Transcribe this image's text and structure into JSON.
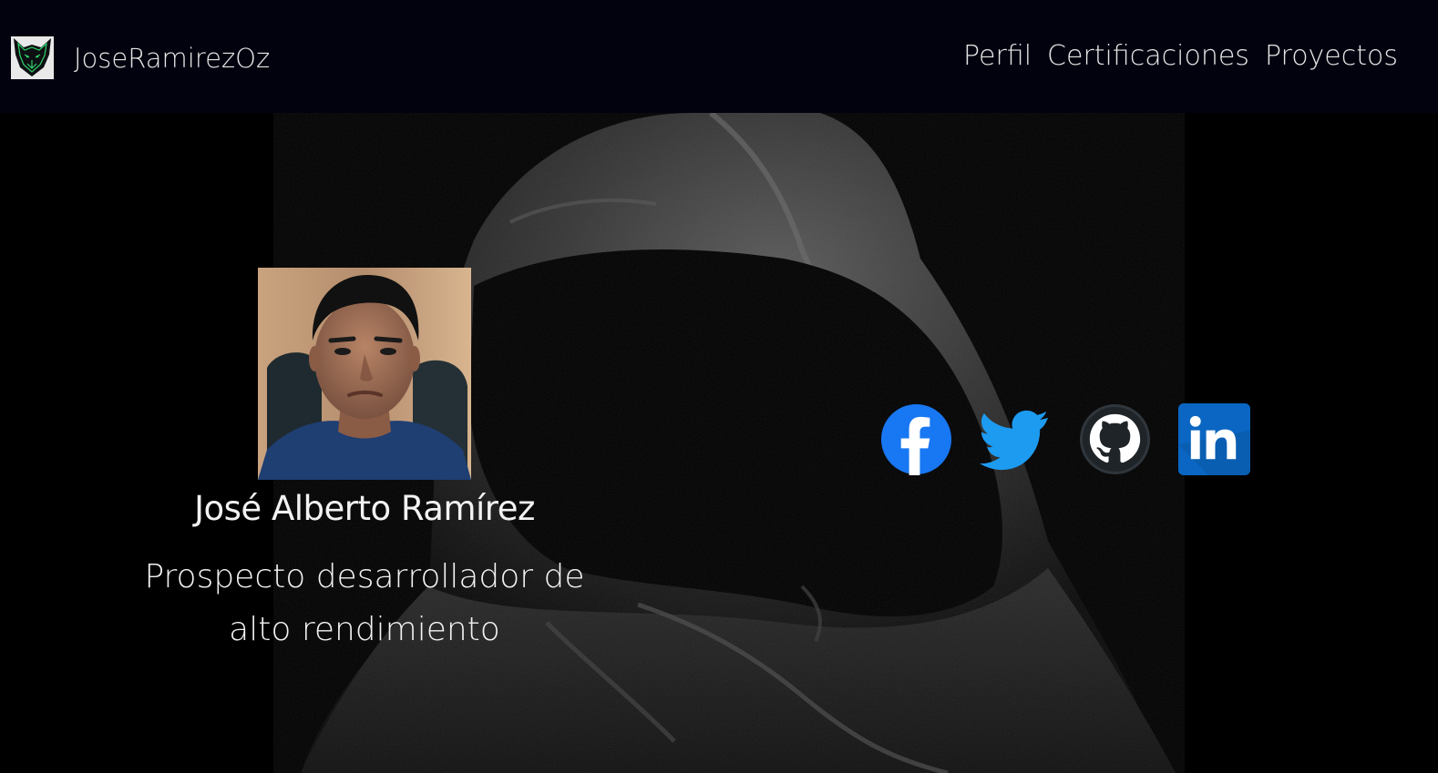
{
  "brand": {
    "name": "JoseRamirezOz"
  },
  "nav": {
    "items": [
      {
        "label": "Perfil"
      },
      {
        "label": "Certificaciones"
      },
      {
        "label": "Proyectos"
      }
    ]
  },
  "profile": {
    "name": "José Alberto Ramírez",
    "tagline": "Prospecto desarrollador de alto rendimiento"
  },
  "social": {
    "items": [
      {
        "icon": "facebook-icon",
        "color": "#1877f2"
      },
      {
        "icon": "twitter-icon",
        "color": "#1d9bf0"
      },
      {
        "icon": "github-icon",
        "color": "#2f363c"
      },
      {
        "icon": "linkedin-icon",
        "color": "#0a66c2"
      }
    ]
  },
  "colors": {
    "navbar_bg": "#02020f",
    "hero_bg": "#000000",
    "text": "#e6e6e6",
    "logo_accent": "#2fd36b"
  }
}
